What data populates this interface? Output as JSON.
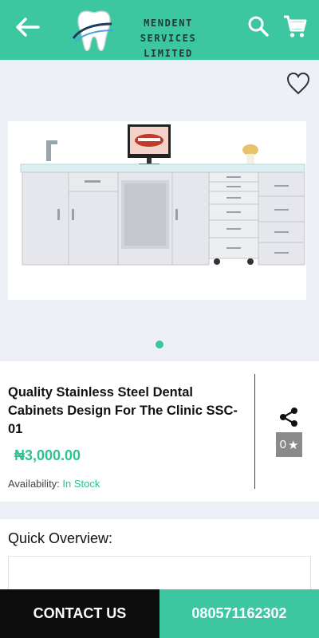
{
  "app": {
    "logo_line1": "MENDENT SERVICES",
    "logo_line2": "LIMITED",
    "icons": {
      "back": "arrow-back-icon",
      "search": "search-icon",
      "cart": "cart-icon",
      "wishlist": "heart-outline-icon",
      "share": "share-icon"
    },
    "colors": {
      "brand": "#3cc7a1",
      "price": "#2ec28c",
      "contact_bg": "#0d0d0d"
    }
  },
  "product": {
    "title": "Quality Stainless Steel Dental Cabinets Design For The Clinic SSC-01",
    "price": "₦3,000.00",
    "availability_label": "Availability:",
    "availability_value": "In Stock",
    "rating": "0",
    "rating_star": "★",
    "gallery_page": 1,
    "gallery_total": 1
  },
  "overview": {
    "title": "Quick Overview:"
  },
  "bottom_bar": {
    "contact_label": "CONTACT US",
    "phone": "080571162302"
  }
}
